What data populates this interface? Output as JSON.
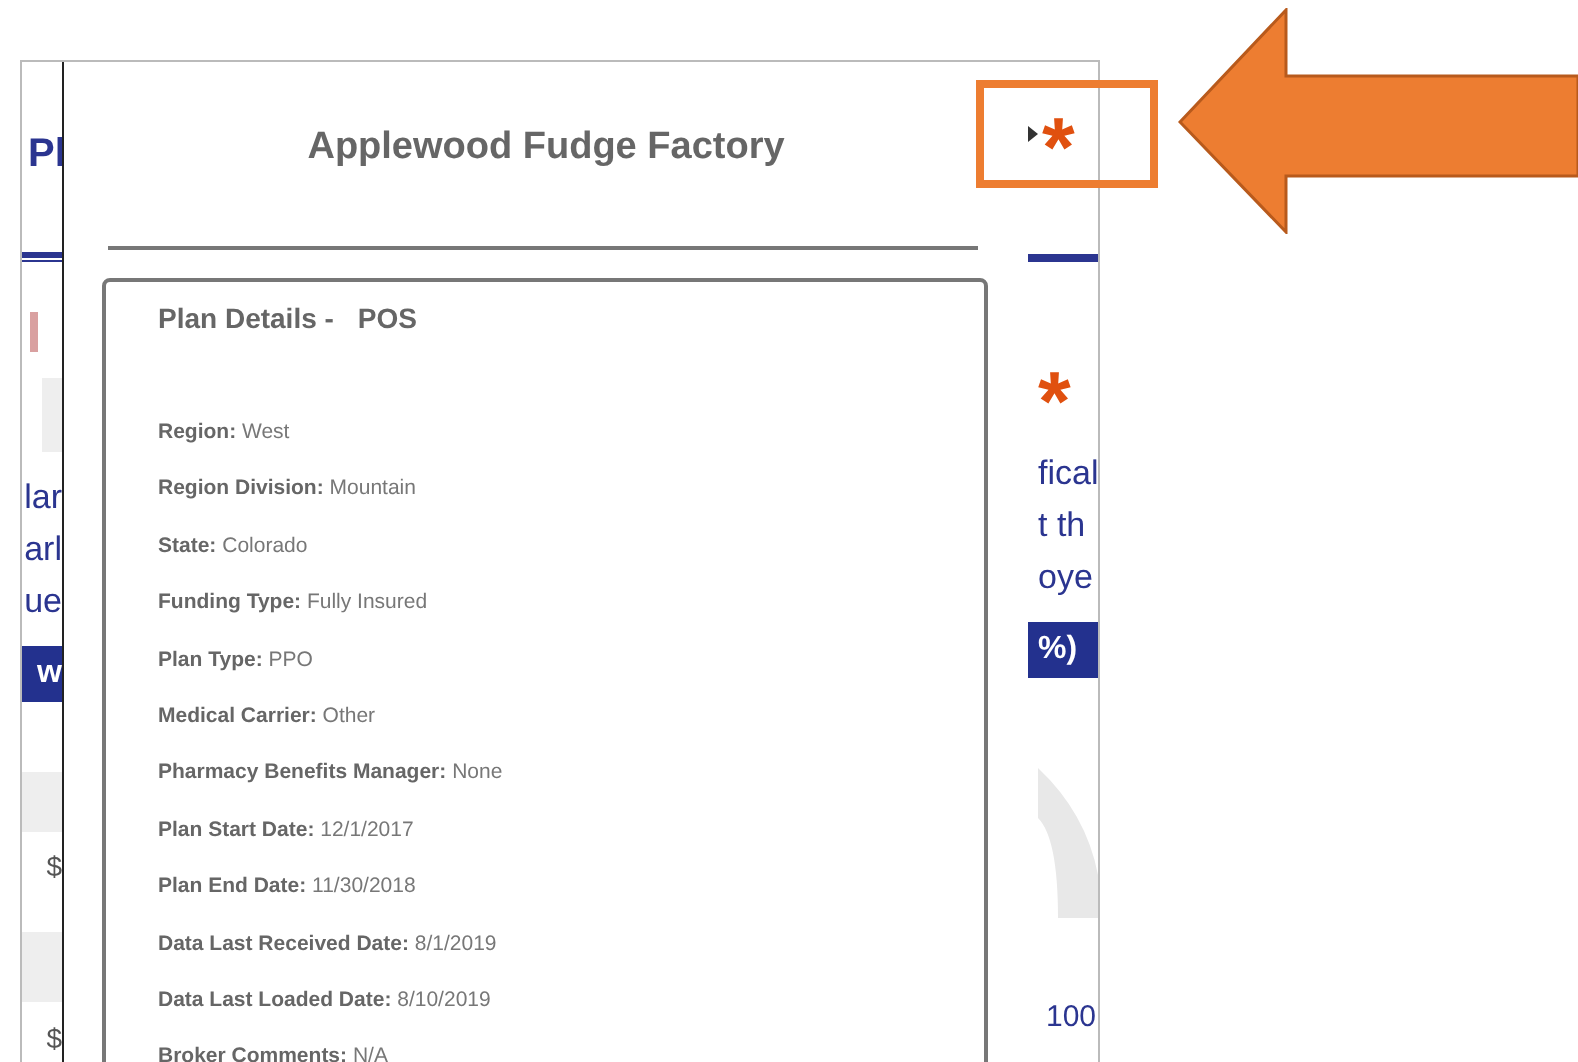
{
  "window": {
    "title": "Applewood Fudge Factory"
  },
  "background_left": {
    "heading": "Pl",
    "lines": [
      "lar",
      "arl",
      "ue"
    ],
    "bar_label": "w",
    "amounts": [
      "$",
      "$"
    ]
  },
  "background_right": {
    "top_marker": "*",
    "marker": "*",
    "lines": [
      "fical",
      "t th",
      "oye"
    ],
    "bar_label": "%)",
    "axis_label": "100"
  },
  "plan_details": {
    "title": "Plan Details -",
    "plan": "POS",
    "fields": [
      {
        "label": "Region:",
        "value": "West"
      },
      {
        "label": "Region Division:",
        "value": "Mountain"
      },
      {
        "label": "State:",
        "value": "Colorado"
      },
      {
        "label": "Funding Type:",
        "value": "Fully Insured"
      },
      {
        "label": "Plan Type:",
        "value": "PPO"
      },
      {
        "label": "Medical Carrier:",
        "value": "Other"
      },
      {
        "label": "Pharmacy Benefits Manager:",
        "value": "None"
      },
      {
        "label": "Plan Start Date:",
        "value": "12/1/2017"
      },
      {
        "label": "Plan End Date:",
        "value": "11/30/2018"
      },
      {
        "label": "Data Last Received Date:",
        "value": "8/1/2019"
      },
      {
        "label": "Data Last Loaded Date:",
        "value": "8/10/2019"
      },
      {
        "label": "Broker Comments:",
        "value": "N/A"
      }
    ]
  }
}
